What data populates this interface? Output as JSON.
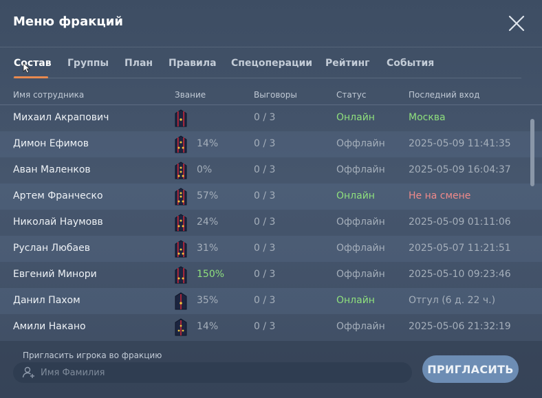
{
  "window": {
    "title": "Меню фракций"
  },
  "tabs": [
    {
      "label": "Состав",
      "active": true
    },
    {
      "label": "Группы"
    },
    {
      "label": "План"
    },
    {
      "label": "Правила"
    },
    {
      "label": "Спецоперации"
    },
    {
      "label": "Рейтинг"
    },
    {
      "label": "События"
    }
  ],
  "table": {
    "headers": {
      "name": "Имя сотрудника",
      "rank": "Звание",
      "reprimands": "Выговоры",
      "status": "Статус",
      "last_login": "Последний вход"
    },
    "rows": [
      {
        "name": "Михаил Акрапович",
        "rank_percent": "",
        "reprimands": "0 / 3",
        "status": "Онлайн",
        "last_login": "Москва"
      },
      {
        "name": "Димон Ефимов",
        "rank_percent": "14%",
        "reprimands": "0 / 3",
        "status": "Оффлайн",
        "last_login": "2025-05-09 11:41:35"
      },
      {
        "name": "Аван Маленков",
        "rank_percent": "0%",
        "reprimands": "0 / 3",
        "status": "Оффлайн",
        "last_login": "2025-05-09 16:04:37"
      },
      {
        "name": "Артем Франческо",
        "rank_percent": "57%",
        "reprimands": "0 / 3",
        "status": "Онлайн",
        "last_login": "Не на смене"
      },
      {
        "name": "Николай Наумовв",
        "rank_percent": "24%",
        "reprimands": "0 / 3",
        "status": "Оффлайн",
        "last_login": "2025-05-09 01:11:06"
      },
      {
        "name": "Руслан Любаев",
        "rank_percent": "31%",
        "reprimands": "0 / 3",
        "status": "Оффлайн",
        "last_login": "2025-05-07 11:21:51"
      },
      {
        "name": "Евгений Минори",
        "rank_percent": "150%",
        "reprimands": "0 / 3",
        "status": "Оффлайн",
        "last_login": "2025-05-10 09:23:46"
      },
      {
        "name": "Данил Пахом",
        "rank_percent": "35%",
        "reprimands": "0 / 3",
        "status": "Онлайн",
        "last_login": "Отгул (6 д. 22 ч.)"
      },
      {
        "name": "Амили Накано",
        "rank_percent": "14%",
        "reprimands": "0 / 3",
        "status": "Оффлайн",
        "last_login": "2025-05-06 21:32:19"
      }
    ]
  },
  "invite": {
    "label": "Пригласить игрока во фракцию",
    "placeholder": "Имя Фамилия",
    "button": "ПРИГЛАСИТЬ"
  },
  "colors": {
    "accent": "#e98a4f",
    "online": "#8fe07d",
    "warning": "#f08a8a",
    "button": "#6d8db4"
  },
  "icons": {
    "close": "close-icon",
    "input": "user-plus-icon",
    "rank": "shoulder-board-icon"
  }
}
